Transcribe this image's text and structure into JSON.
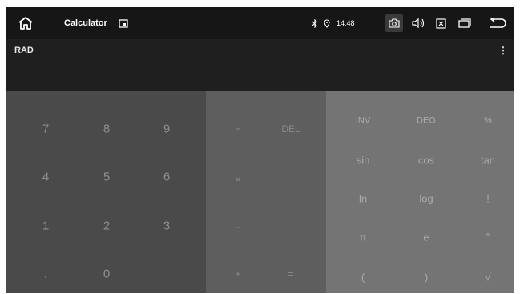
{
  "status_bar": {
    "app_title": "Calculator",
    "time": "14:48"
  },
  "display": {
    "mode": "RAD",
    "menu_glyph": "⋮"
  },
  "keypad": {
    "numbers": {
      "row1": [
        "7",
        "8",
        "9"
      ],
      "row2": [
        "4",
        "5",
        "6"
      ],
      "row3": [
        "1",
        "2",
        "3"
      ],
      "row4": [
        ".",
        "0"
      ]
    },
    "operators": {
      "divide": "÷",
      "delete": "DEL",
      "multiply": "×",
      "minus": "−",
      "plus": "+",
      "equals": "="
    },
    "advanced": {
      "row1": [
        "INV",
        "DEG",
        "%"
      ],
      "row2": [
        "sin",
        "cos",
        "tan"
      ],
      "row3": [
        "ln",
        "log",
        "!"
      ],
      "row4": [
        "π",
        "e",
        "^"
      ],
      "row5": [
        "(",
        ")",
        "√"
      ]
    }
  },
  "icons": {
    "home": "home-icon",
    "app": "app-icon",
    "bluetooth": "bluetooth-icon",
    "location": "location-icon",
    "camera": "camera-icon",
    "volume": "volume-icon",
    "close": "close-icon",
    "recents": "recents-icon",
    "back": "back-icon"
  },
  "colors": {
    "status_bar_bg": "#161616",
    "display_bg": "#1f1f1f",
    "numbers_pad_bg": "#4a4a4a",
    "operators_pad_bg": "#5e5e5e",
    "advanced_pad_bg": "#747474"
  }
}
